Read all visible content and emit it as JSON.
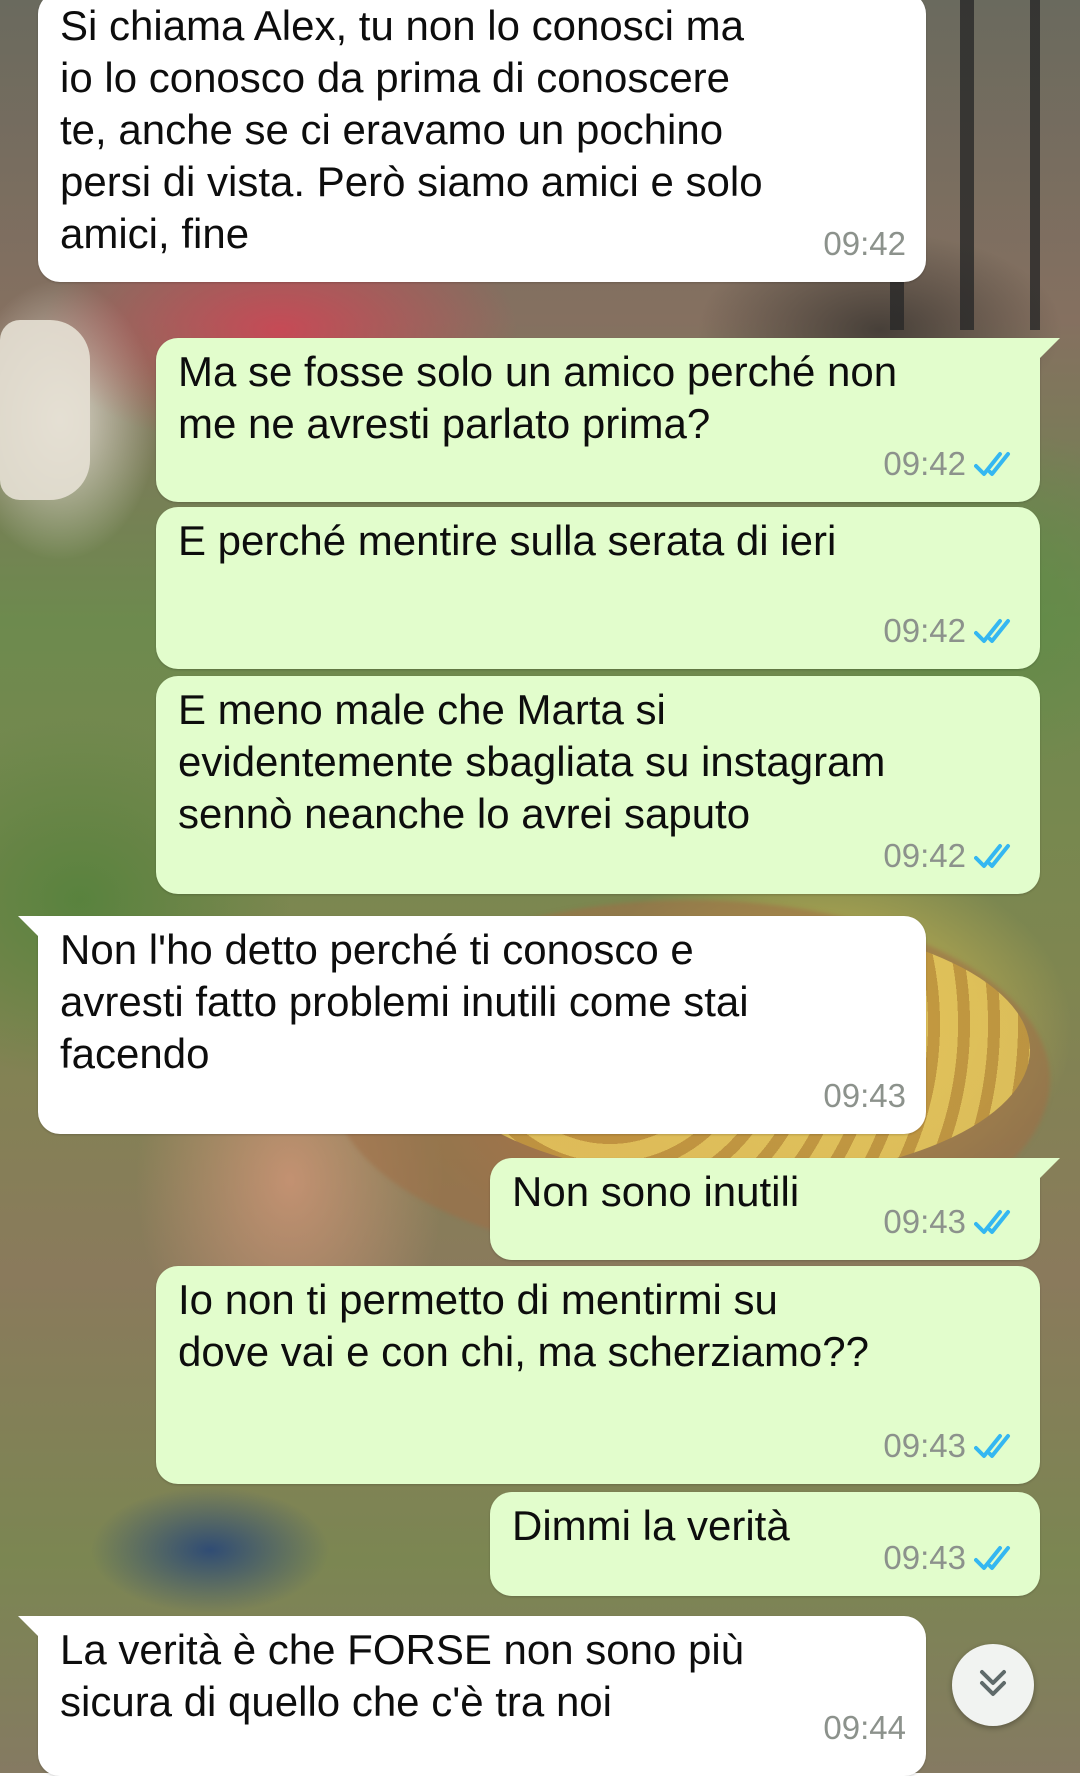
{
  "conversation": {
    "messages": [
      {
        "direction": "incoming",
        "text": "Si chiama Alex, tu non lo conosci ma\nio lo conosco da prima di conoscere\nte, anche se ci eravamo un pochino\npersi di vista. Però siamo amici e solo\namici, fine",
        "time": "09:42"
      },
      {
        "direction": "outgoing",
        "text": "Ma se fosse solo un amico perché non\nme ne avresti parlato prima?",
        "time": "09:42",
        "status": "read"
      },
      {
        "direction": "outgoing",
        "text": "E perché mentire sulla serata di ieri",
        "time": "09:42",
        "status": "read"
      },
      {
        "direction": "outgoing",
        "text": "E meno male che Marta si\nevidentemente sbagliata su instagram\nsennò neanche lo avrei saputo",
        "time": "09:42",
        "status": "read"
      },
      {
        "direction": "incoming",
        "text": "Non l'ho detto perché ti conosco e\navresti fatto problemi inutili come stai\nfacendo",
        "time": "09:43"
      },
      {
        "direction": "outgoing",
        "text": "Non sono inutili",
        "time": "09:43",
        "status": "read"
      },
      {
        "direction": "outgoing",
        "text": "Io non ti permetto di mentirmi su\ndove vai e con chi, ma scherziamo??",
        "time": "09:43",
        "status": "read"
      },
      {
        "direction": "outgoing",
        "text": "Dimmi la verità",
        "time": "09:43",
        "status": "read"
      },
      {
        "direction": "incoming",
        "text": "La verità è che FORSE non sono più\nsicura di quello che c'è tra noi",
        "time": "09:44"
      }
    ]
  },
  "icons": {
    "read_receipt": "double-check-icon",
    "scroll_down": "double-chevron-down-icon"
  },
  "colors": {
    "incoming_bubble": "#ffffff",
    "outgoing_bubble": "#e2fdcc",
    "read_tick": "#34b7f1",
    "timestamp": "#8c928c"
  }
}
